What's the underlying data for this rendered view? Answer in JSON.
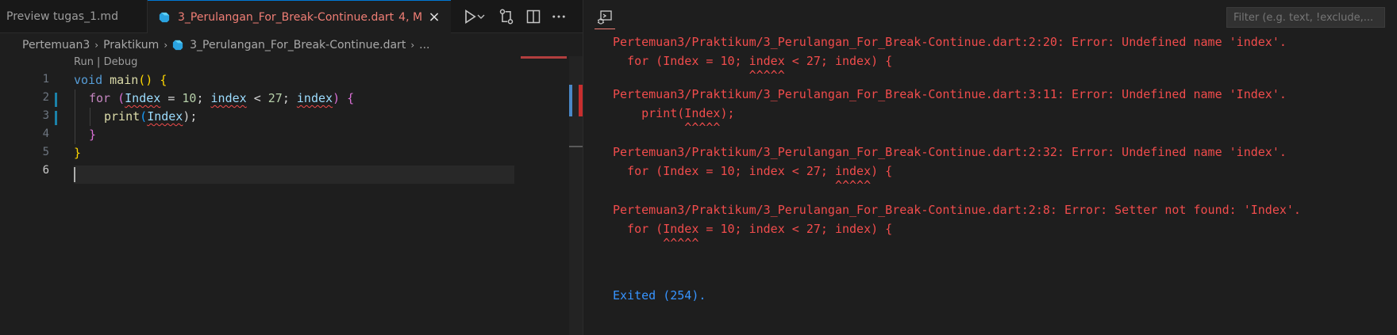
{
  "tabs": {
    "inactive_label": "Preview tugas_1.md",
    "active_label": "3_Perulangan_For_Break-Continue.dart",
    "active_badge": "4, M",
    "close_icon": "×"
  },
  "breadcrumb": {
    "items": [
      "Pertemuan3",
      "Praktikum",
      "3_Perulangan_For_Break-Continue.dart",
      "..."
    ]
  },
  "editor": {
    "codelens": "Run | Debug",
    "line_numbers": [
      "1",
      "2",
      "3",
      "4",
      "5",
      "6"
    ],
    "code": {
      "l1_kw": "void",
      "l1_fn": "main",
      "l1_paren": "()",
      "l1_brace": "{",
      "l2_kw": "for",
      "l2_open": "(",
      "l2_v1": "Index",
      "l2_eq": " = ",
      "l2_n1": "10",
      "l2_semi1": "; ",
      "l2_v2": "index",
      "l2_lt": " < ",
      "l2_n2": "27",
      "l2_semi2": "; ",
      "l2_v3": "index",
      "l2_close": ")",
      "l2_brace": "{",
      "l3_fn": "print",
      "l3_open": "(",
      "l3_v": "Index",
      "l3_close": ");",
      "l4_brace": "}",
      "l5_brace": "}"
    }
  },
  "output": {
    "filter_placeholder": "Filter (e.g. text, !exclude,...",
    "lines": [
      "Pertemuan3/Praktikum/3_Perulangan_For_Break-Continue.dart:2:20: Error: Undefined name 'index'.",
      "  for (Index = 10; index < 27; index) {",
      "                   ^^^^^",
      "Pertemuan3/Praktikum/3_Perulangan_For_Break-Continue.dart:3:11: Error: Undefined name 'Index'.",
      "    print(Index);",
      "          ^^^^^",
      "Pertemuan3/Praktikum/3_Perulangan_For_Break-Continue.dart:2:32: Error: Undefined name 'index'.",
      "  for (Index = 10; index < 27; index) {",
      "                               ^^^^^",
      "Pertemuan3/Praktikum/3_Perulangan_For_Break-Continue.dart:2:8: Error: Setter not found: 'Index'.",
      "  for (Index = 10; index < 27; index) {",
      "       ^^^^^"
    ],
    "exit_text": "Exited (254)."
  },
  "colors": {
    "error": "#f14c4c",
    "exit": "#3794ff",
    "active_tab_text": "#f07e75"
  }
}
